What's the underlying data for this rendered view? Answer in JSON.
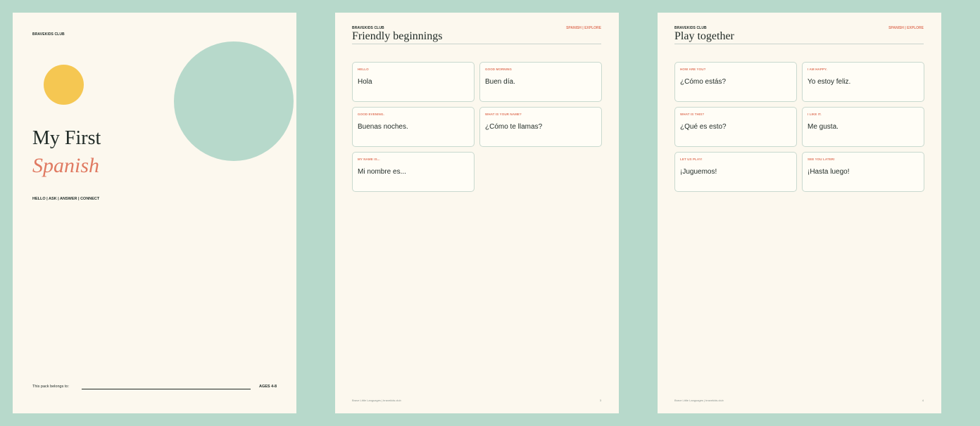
{
  "cover": {
    "brand": "BRAVEKIDS CLUB",
    "title": "My First",
    "subtitle": "Spanish",
    "tagline": "HELLO | ASK | ANSWER | CONNECT",
    "belongs_label": "This pack belongs to:",
    "ages": "AGES 4-8"
  },
  "pages": [
    {
      "brand": "BRAVEKIDS CLUB",
      "section": "SPANISH | EXPLORE",
      "heading": "Friendly beginnings",
      "cards": [
        {
          "label": "HELLO",
          "phrase": "Hola"
        },
        {
          "label": "GOOD MORNING",
          "phrase": "Buen día."
        },
        {
          "label": "GOOD EVENING.",
          "phrase": "Buenas noches."
        },
        {
          "label": "WHAT IS YOUR NAME?",
          "phrase": "¿Cómo te llamas?"
        },
        {
          "label": "MY NAME IS...",
          "phrase": "Mi nombre es..."
        }
      ],
      "footer": "Brave Little Languages | bravekids.club",
      "page_number": "3"
    },
    {
      "brand": "BRAVEKIDS CLUB",
      "section": "SPANISH | EXPLORE",
      "heading": "Play together",
      "cards": [
        {
          "label": "HOW ARE YOU?",
          "phrase": "¿Cómo estás?"
        },
        {
          "label": "I AM HAPPY.",
          "phrase": "Yo estoy feliz."
        },
        {
          "label": "WHAT IS THIS?",
          "phrase": "¿Qué es esto?"
        },
        {
          "label": "I LIKE IT.",
          "phrase": "Me gusta."
        },
        {
          "label": "LET US PLAY!",
          "phrase": "¡Juguemos!"
        },
        {
          "label": "SEE YOU LATER!",
          "phrase": "¡Hasta luego!"
        }
      ],
      "footer": "Brave Little Languages | bravekids.club",
      "page_number": "4"
    }
  ],
  "colors": {
    "background": "#b7d9cb",
    "paper": "#fcf8ee",
    "accent": "#e07a62",
    "sun": "#f5c752",
    "ink": "#1f2a26"
  }
}
